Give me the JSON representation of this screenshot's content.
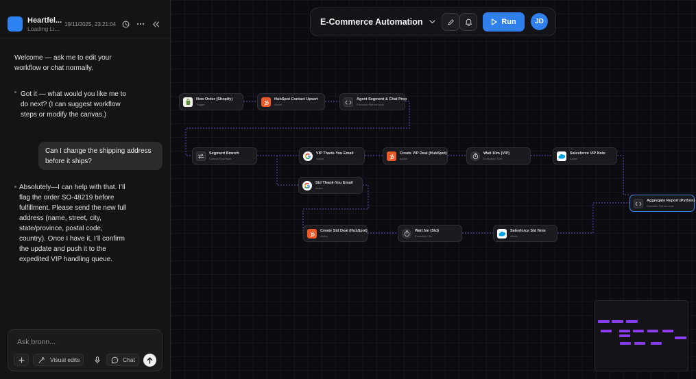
{
  "panel": {
    "app_title": "Heartfel...",
    "app_subtitle": "Loading Li...",
    "timestamp": "19/11/2025, 23:21:04",
    "icons": {
      "history": "clock-icon",
      "more": "ellipsis-icon",
      "collapse": "double-chevron-left-icon"
    },
    "messages": [
      {
        "role": "assistant",
        "text": "Welcome — ask me to edit your workflow or chat normally."
      },
      {
        "role": "assistant",
        "text": "Got it — what would you like me to do next? (I can suggest workflow steps or modify the canvas.)"
      },
      {
        "role": "user",
        "text": "Can I change the shipping address before it ships?"
      },
      {
        "role": "assistant",
        "text": "Absolutely—I can help with that. I’ll flag the order SO-48219 before fulfillment. Please send the new full address (name, street, city, state/province, postal code, country). Once I have it, I’ll confirm the update and push it to the expedited VIP handling queue."
      }
    ],
    "composer": {
      "placeholder": "Ask bronn...",
      "visual_edits_label": "Visual edits",
      "chat_label": "Chat"
    }
  },
  "toolbar": {
    "workflow_name": "E-Commerce Automation",
    "run_label": "Run",
    "avatar_initials": "JD"
  },
  "nodes": {
    "new_order": {
      "title": "New Order (Shopify)",
      "subtitle": "Trigger"
    },
    "hubspot_upsert": {
      "title": "HubSpot Contact Upsert",
      "subtitle": "Action"
    },
    "agent_segment": {
      "title": "Agent Segment & Chat Prep",
      "subtitle": "Executes Python code"
    },
    "segment_branch": {
      "title": "Segment Branch",
      "subtitle": "Control Flow/Input"
    },
    "vip_email": {
      "title": "VIP Thank-You Email",
      "subtitle": "Action"
    },
    "vip_deal": {
      "title": "Create VIP Deal (HubSpot)",
      "subtitle": "Action"
    },
    "wait_vip": {
      "title": "Wait 10m (VIP)",
      "subtitle": "Execution: 10m"
    },
    "sf_vip_note": {
      "title": "Salesforce VIP Note",
      "subtitle": "Action"
    },
    "std_email": {
      "title": "Std Thank-You Email",
      "subtitle": "Action"
    },
    "std_deal": {
      "title": "Create Std Deal (HubSpot)",
      "subtitle": "Action"
    },
    "wait_std": {
      "title": "Wait 5m (Std)",
      "subtitle": "Execution: 5m"
    },
    "sf_std_note": {
      "title": "Salesforce Std Note",
      "subtitle": "Action"
    },
    "aggregate": {
      "title": "Aggregate Report (Python)",
      "subtitle": "Executes Python code"
    }
  },
  "colors": {
    "accent": "#2f80ed",
    "edge": "#6f5bd6",
    "minimap_node": "#8a3cf0",
    "hubspot": "#ee5b2b"
  }
}
